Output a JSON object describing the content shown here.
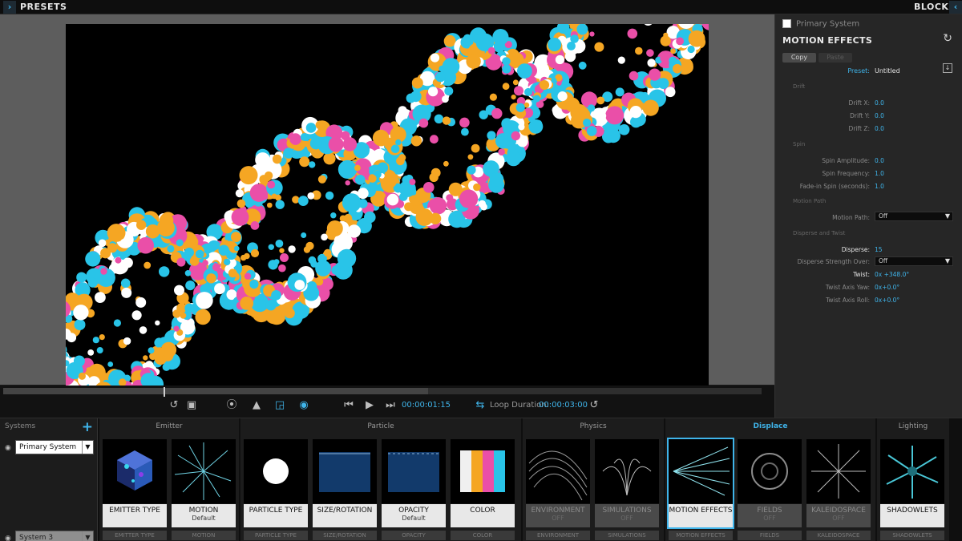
{
  "topbar": {
    "left_label": "PRESETS",
    "right_label": "BLOCKS"
  },
  "transport": {
    "timecode": "00:00:01:15",
    "loop_label": "Loop Duration:",
    "loop_value": "00:00:03:00"
  },
  "panel": {
    "system_checkbox_label": "Primary System",
    "title": "MOTION EFFECTS",
    "copy_label": "Copy",
    "paste_label": "Paste",
    "preset_label": "Preset:",
    "preset_value": "Untitled",
    "sections": [
      "Drift",
      "Spin",
      "Motion Path",
      "Disperse and Twist"
    ],
    "params": [
      {
        "label": "Drift X:",
        "value": "0.0"
      },
      {
        "label": "Drift Y:",
        "value": "0.0"
      },
      {
        "label": "Drift Z:",
        "value": "0.0"
      },
      {
        "label": "Spin Amplitude:",
        "value": "0.0"
      },
      {
        "label": "Spin Frequency:",
        "value": "1.0"
      },
      {
        "label": "Fade-in Spin (seconds):",
        "value": "1.0"
      },
      {
        "label": "Motion Path:",
        "value": "Off"
      },
      {
        "label": "Disperse:",
        "value": "15"
      },
      {
        "label": "Disperse Strength Over:",
        "value": "Off"
      },
      {
        "label": "Twist:",
        "value": "0x +348.0°"
      },
      {
        "label": "Twist Axis Yaw:",
        "value": "0x+0.0°"
      },
      {
        "label": "Twist Axis Roll:",
        "value": "0x+0.0°"
      }
    ]
  },
  "systems": {
    "header": "Systems",
    "items": [
      "Primary System",
      "System 3"
    ]
  },
  "groups": [
    {
      "name": "Emitter",
      "tiles": [
        {
          "title": "EMITTER TYPE",
          "sub": "",
          "below": "EMITTER TYPE"
        },
        {
          "title": "MOTION",
          "sub": "Default",
          "below": "MOTION"
        }
      ]
    },
    {
      "name": "Particle",
      "tiles": [
        {
          "title": "PARTICLE TYPE",
          "sub": "",
          "below": "PARTICLE TYPE"
        },
        {
          "title": "SIZE/ROTATION",
          "sub": "",
          "below": "SIZE/ROTATION"
        },
        {
          "title": "OPACITY",
          "sub": "Default",
          "below": "OPACITY"
        },
        {
          "title": "COLOR",
          "sub": "",
          "below": "COLOR"
        }
      ]
    },
    {
      "name": "Physics",
      "tiles": [
        {
          "title": "ENVIRONMENT",
          "sub": "OFF",
          "below": "ENVIRONMENT"
        },
        {
          "title": "SIMULATIONS",
          "sub": "OFF",
          "below": "SIMULATIONS"
        }
      ]
    },
    {
      "name": "Displace",
      "tiles": [
        {
          "title": "MOTION EFFECTS",
          "sub": "",
          "below": "MOTION EFFECTS"
        },
        {
          "title": "FIELDS",
          "sub": "OFF",
          "below": "FIELDS"
        },
        {
          "title": "KALEIDOSPACE",
          "sub": "OFF",
          "below": "KALEIDOSPACE"
        }
      ]
    },
    {
      "name": "Lighting",
      "tiles": [
        {
          "title": "SHADOWLETS",
          "sub": "",
          "below": "SHADOWLETS"
        }
      ]
    }
  ],
  "colors": {
    "accent": "#3fb4ea",
    "particle_orange": "#f5a623",
    "particle_cyan": "#29c4e8",
    "particle_pink": "#ea4fa8",
    "particle_white": "#ffffff"
  }
}
